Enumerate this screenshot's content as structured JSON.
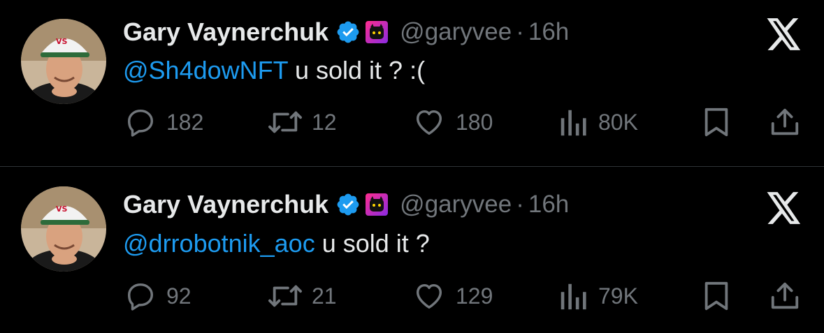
{
  "colors": {
    "background": "#000000",
    "text_primary": "#e7e9ea",
    "text_secondary": "#71767b",
    "mention": "#1d9bf0",
    "verified": "#1d9bf0",
    "divider": "#2f3336"
  },
  "tweets": [
    {
      "author": {
        "name": "Gary Vaynerchuk",
        "handle": "@garyvee",
        "separator": "·",
        "time": "16h",
        "avatar": "avatar-photo",
        "badges": [
          "verified-badge-icon",
          "affiliate-badge-icon"
        ]
      },
      "mention": "@Sh4dowNFT",
      "text": " u sold it ? :(",
      "stats": {
        "replies": "182",
        "reposts": "12",
        "likes": "180",
        "views": "80K"
      },
      "icons": [
        "reply-icon",
        "repost-icon",
        "like-icon",
        "views-icon",
        "bookmark-icon",
        "share-icon",
        "x-logo-icon"
      ]
    },
    {
      "author": {
        "name": "Gary Vaynerchuk",
        "handle": "@garyvee",
        "separator": "·",
        "time": "16h",
        "avatar": "avatar-photo",
        "badges": [
          "verified-badge-icon",
          "affiliate-badge-icon"
        ]
      },
      "mention": "@drrobotnik_aoc",
      "text": " u sold it ?",
      "stats": {
        "replies": "92",
        "reposts": "21",
        "likes": "129",
        "views": "79K"
      },
      "icons": [
        "reply-icon",
        "repost-icon",
        "like-icon",
        "views-icon",
        "bookmark-icon",
        "share-icon",
        "x-logo-icon"
      ]
    }
  ]
}
